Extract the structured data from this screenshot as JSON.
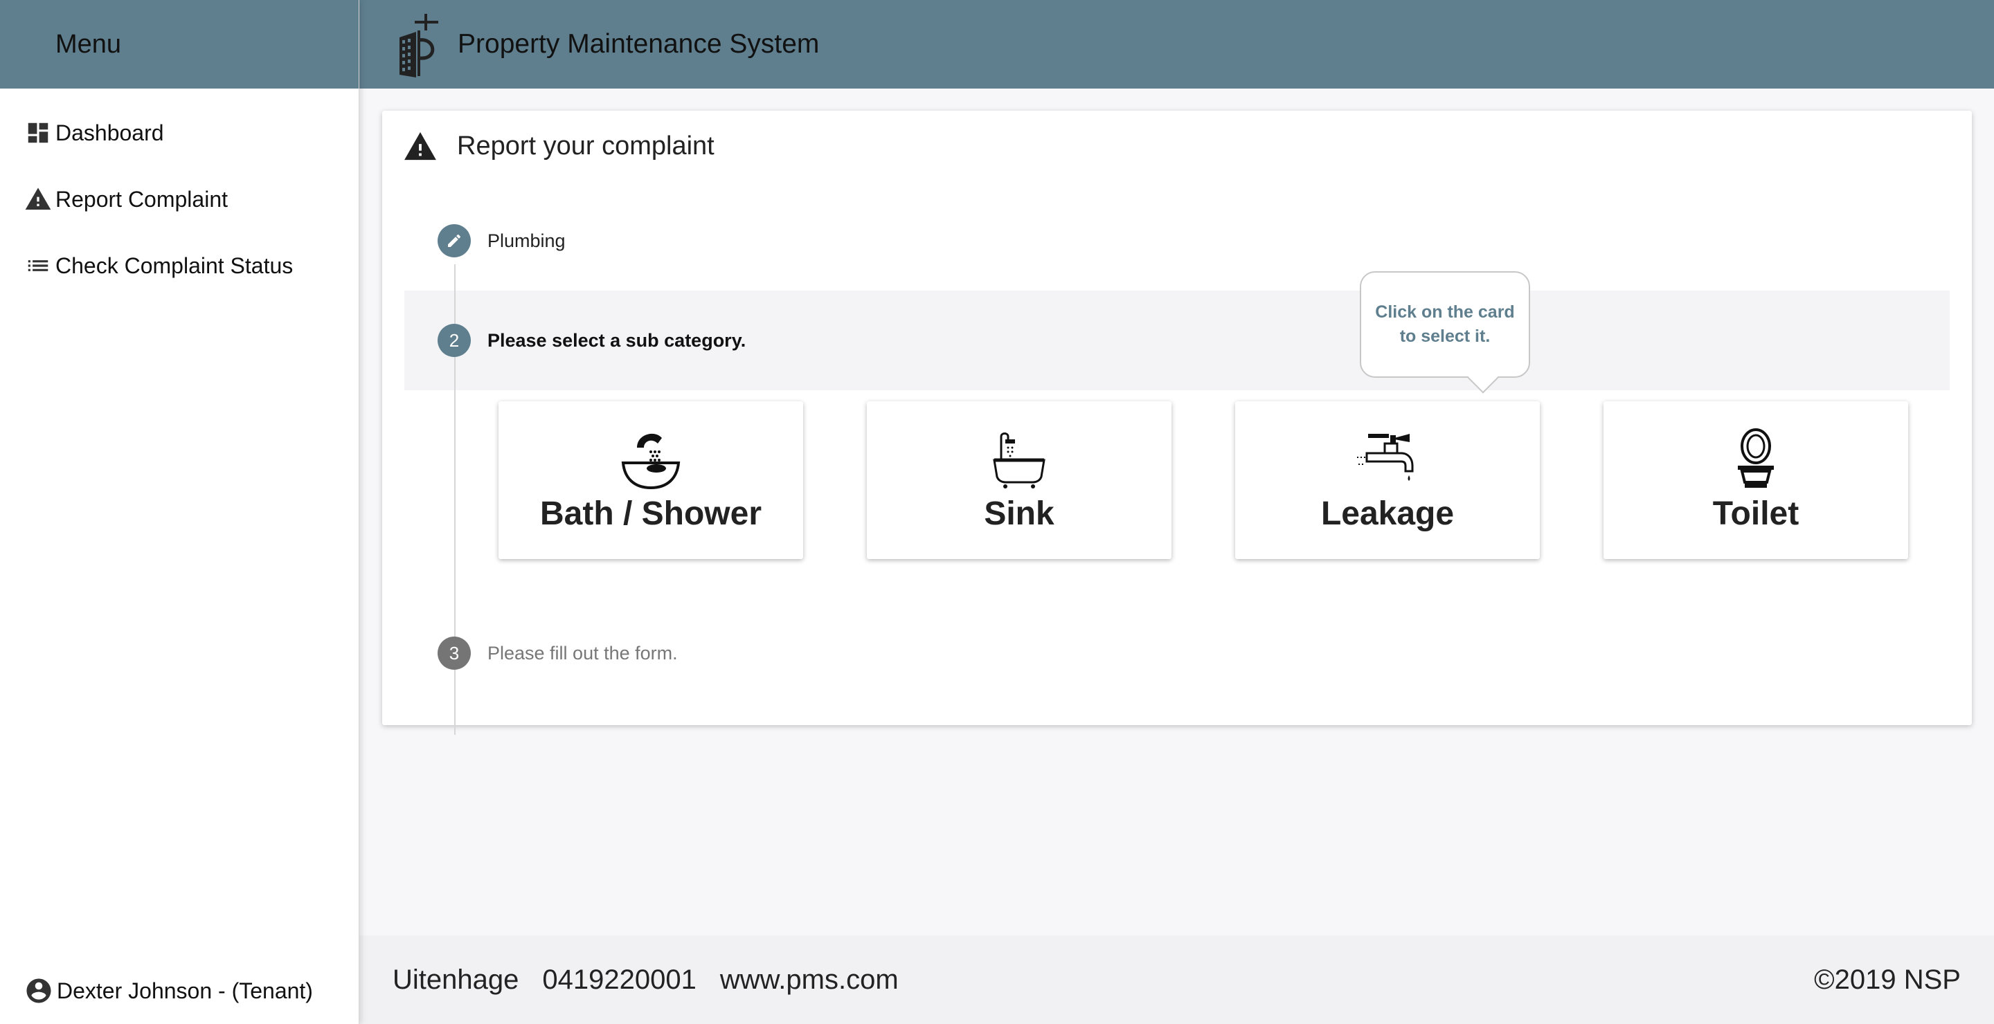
{
  "sidebar": {
    "menu_title": "Menu",
    "items": [
      {
        "label": "Dashboard",
        "icon": "dashboard-icon"
      },
      {
        "label": "Report Complaint",
        "icon": "warning-icon"
      },
      {
        "label": "Check Complaint Status",
        "icon": "list-icon"
      }
    ],
    "user": {
      "label": "Dexter Johnson - (Tenant)",
      "icon": "account-circle-icon"
    }
  },
  "header": {
    "title": "Property Maintenance System",
    "logo": "building-logo"
  },
  "card": {
    "title": "Report your complaint",
    "steps": [
      {
        "number": "",
        "label": "Plumbing",
        "state": "done",
        "icon": "pencil-icon"
      },
      {
        "number": "2",
        "label": "Please select a sub category.",
        "state": "active"
      },
      {
        "number": "3",
        "label": "Please fill out the form.",
        "state": "pending"
      }
    ],
    "tiles": [
      {
        "label": "Bath / Shower",
        "icon": "shower-icon"
      },
      {
        "label": "Sink",
        "icon": "bathtub-icon"
      },
      {
        "label": "Leakage",
        "icon": "faucet-leak-icon"
      },
      {
        "label": "Toilet",
        "icon": "toilet-icon"
      }
    ],
    "tooltip": {
      "line1": "Click on the card",
      "line2": "to select it."
    }
  },
  "footer": {
    "city": "Uitenhage",
    "phone": "0419220001",
    "website": "www.pms.com",
    "copyright": "©2019 NSP"
  },
  "colors": {
    "primary": "#5f7f8e",
    "step_idle": "#757575",
    "background": "#f7f7f9"
  }
}
